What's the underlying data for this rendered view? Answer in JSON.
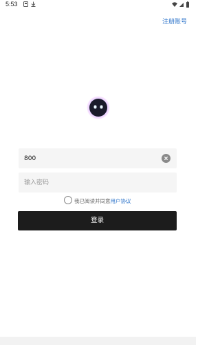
{
  "status_bar": {
    "time": "5:53"
  },
  "header": {
    "register_label": "注册账号"
  },
  "form": {
    "account_value": "800",
    "password_placeholder": "输入密码"
  },
  "agreement": {
    "text": "我已阅读并同意",
    "link_label": "用户协议"
  },
  "login_button_label": "登录",
  "colors": {
    "accent": "#2a72c9",
    "button_bg": "#1c1c1c",
    "field_bg": "#f5f5f5"
  }
}
